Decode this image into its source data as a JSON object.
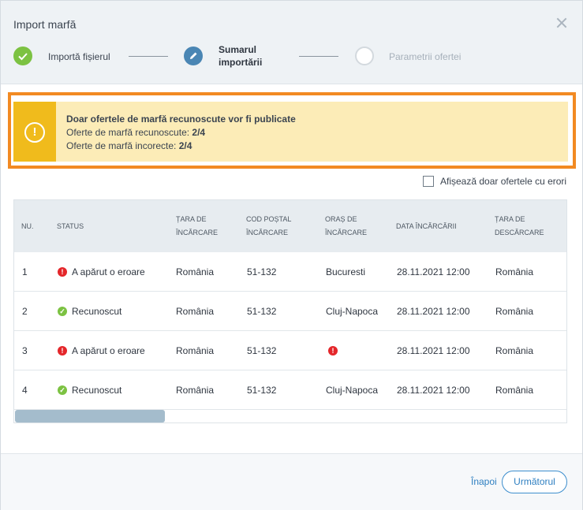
{
  "modal": {
    "title": "Import marfă"
  },
  "steps": [
    {
      "label": "Importă fișierul",
      "state": "done",
      "icon": "check-icon"
    },
    {
      "label": "Sumarul importării",
      "state": "active",
      "icon": "pencil-icon"
    },
    {
      "label": "Parametrii ofertei",
      "state": "inactive",
      "icon": ""
    }
  ],
  "alert": {
    "title": "Doar ofertele de marfă recunoscute vor fi publicate",
    "recognized_label": "Oferte de marfă recunoscute:",
    "recognized_value": "2/4",
    "incorrect_label": "Oferte de marfă incorecte:",
    "incorrect_value": "2/4",
    "accent": "#f0bb1c"
  },
  "filter": {
    "label": "Afișează doar ofertele cu erori",
    "checked": false
  },
  "table": {
    "columns": [
      "NU.",
      "STATUS",
      "ȚARA DE ÎNCĂRCARE",
      "COD POȘTAL ÎNCĂRCARE",
      "ORAȘ DE ÎNCĂRCARE",
      "DATA ÎNCĂRCĂRII",
      "ȚARA DE DESCĂRCARE"
    ],
    "rows": [
      {
        "nr": "1",
        "status": "A apărut o eroare",
        "status_type": "error",
        "country": "România",
        "postal": "51-132",
        "city": "Bucuresti",
        "date": "28.11.2021 12:00",
        "unload_country": "România"
      },
      {
        "nr": "2",
        "status": "Recunoscut",
        "status_type": "ok",
        "country": "România",
        "postal": "51-132",
        "city": "Cluj-Napoca",
        "date": "28.11.2021 12:00",
        "unload_country": "România"
      },
      {
        "nr": "3",
        "status": "A apărut o eroare",
        "status_type": "error",
        "country": "România",
        "postal": "51-132",
        "city": "",
        "date": "28.11.2021 12:00",
        "unload_country": "România"
      },
      {
        "nr": "4",
        "status": "Recunoscut",
        "status_type": "ok",
        "country": "România",
        "postal": "51-132",
        "city": "Cluj-Napoca",
        "date": "28.11.2021 12:00",
        "unload_country": "România"
      }
    ]
  },
  "footer": {
    "back_label": "Înapoi",
    "next_label": "Următorul"
  }
}
